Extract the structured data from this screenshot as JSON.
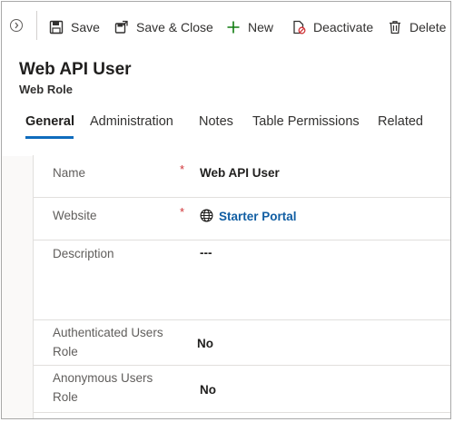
{
  "toolbar": {
    "save_label": "Save",
    "save_close_label": "Save & Close",
    "new_label": "New",
    "deactivate_label": "Deactivate",
    "delete_label": "Delete"
  },
  "header": {
    "title": "Web API User",
    "subtitle": "Web Role"
  },
  "tabs": [
    {
      "label": "General",
      "active": true
    },
    {
      "label": "Administration",
      "active": false
    },
    {
      "label": "Notes",
      "active": false
    },
    {
      "label": "Table Permissions",
      "active": false
    },
    {
      "label": "Related",
      "active": false
    }
  ],
  "form": {
    "name": {
      "label": "Name",
      "required_mark": "*",
      "value": "Web API User"
    },
    "website": {
      "label": "Website",
      "required_mark": "*",
      "value": "Starter Portal"
    },
    "description": {
      "label": "Description",
      "value": "---"
    },
    "authenticated_users_role": {
      "label": "Authenticated Users Role",
      "value": "No"
    },
    "anonymous_users_role": {
      "label": "Anonymous Users Role",
      "value": "No"
    }
  },
  "colors": {
    "accent": "#0f6cbd",
    "link": "#115ea3",
    "required": "#d13438",
    "new_icon": "#107c10"
  },
  "icons": [
    "chevron-right-icon",
    "save-icon",
    "save-close-icon",
    "plus-icon",
    "deactivate-icon",
    "trash-icon",
    "globe-icon"
  ]
}
